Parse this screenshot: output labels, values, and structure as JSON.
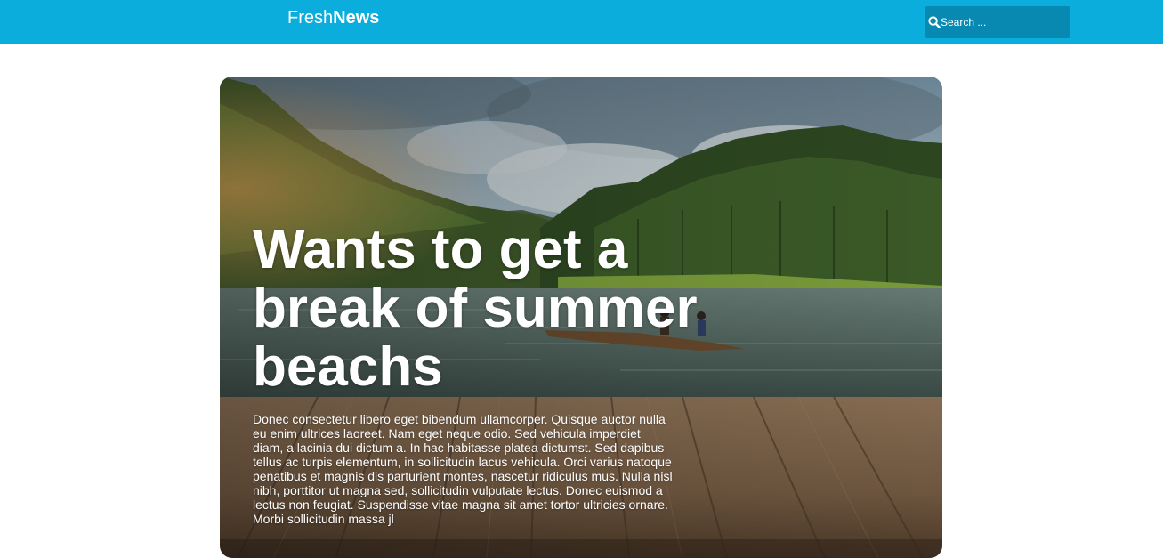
{
  "header": {
    "logo_light": "Fresh",
    "logo_bold": "News",
    "brand_color": "#0aaddc",
    "search": {
      "placeholder": "Search ...",
      "value": "",
      "icon": "search-icon"
    }
  },
  "hero": {
    "title": "Wants to get a break of summer beachs",
    "body": "Donec consectetur libero eget bibendum ullamcorper. Quisque auctor nulla eu enim ultrices laoreet. Nam eget neque odio. Sed vehicula imperdiet diam, a lacinia dui dictum a. In hac habitasse platea dictumst. Sed dapibus tellus ac turpis elementum, in sollicitudin lacus vehicula. Orci varius natoque penatibus et magnis dis parturient montes, nascetur ridiculus mus. Nulla nisl nibh, porttitor ut magna sed, sollicitudin vulputate lectus. Donec euismod a lectus non feugiat. Suspendisse vitae magna sit amet tortor ultricies ornare. Morbi sollicitudin massa jl"
  }
}
